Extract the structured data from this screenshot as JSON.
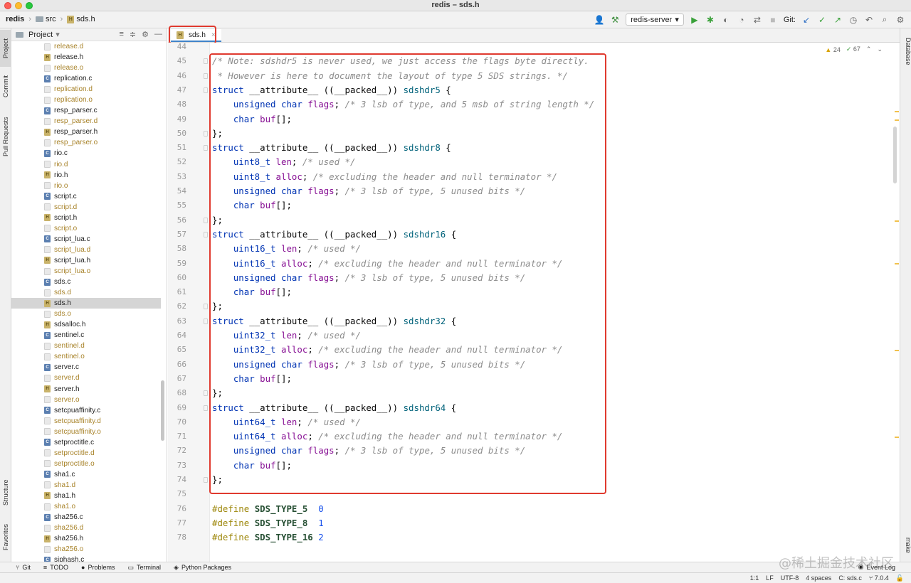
{
  "window": {
    "title": "redis – sds.h"
  },
  "breadcrumbs": [
    "redis",
    "src",
    "sds.h"
  ],
  "toolbar": {
    "run_config": "redis-server",
    "git_label": "Git:"
  },
  "left_strip": {
    "project": "Project",
    "commit": "Commit",
    "pull_requests": "Pull Requests",
    "structure": "Structure",
    "favorites": "Favorites"
  },
  "right_strip": {
    "database": "Database",
    "make": "make"
  },
  "project_panel": {
    "title": "Project"
  },
  "files": [
    {
      "name": "release.d",
      "type": "gen"
    },
    {
      "name": "release.h",
      "type": "h"
    },
    {
      "name": "release.o",
      "type": "gen"
    },
    {
      "name": "replication.c",
      "type": "c"
    },
    {
      "name": "replication.d",
      "type": "gen"
    },
    {
      "name": "replication.o",
      "type": "gen"
    },
    {
      "name": "resp_parser.c",
      "type": "c"
    },
    {
      "name": "resp_parser.d",
      "type": "gen"
    },
    {
      "name": "resp_parser.h",
      "type": "h"
    },
    {
      "name": "resp_parser.o",
      "type": "gen"
    },
    {
      "name": "rio.c",
      "type": "c"
    },
    {
      "name": "rio.d",
      "type": "gen"
    },
    {
      "name": "rio.h",
      "type": "h"
    },
    {
      "name": "rio.o",
      "type": "gen"
    },
    {
      "name": "script.c",
      "type": "c"
    },
    {
      "name": "script.d",
      "type": "gen"
    },
    {
      "name": "script.h",
      "type": "h"
    },
    {
      "name": "script.o",
      "type": "gen"
    },
    {
      "name": "script_lua.c",
      "type": "c"
    },
    {
      "name": "script_lua.d",
      "type": "gen"
    },
    {
      "name": "script_lua.h",
      "type": "h"
    },
    {
      "name": "script_lua.o",
      "type": "gen"
    },
    {
      "name": "sds.c",
      "type": "c"
    },
    {
      "name": "sds.d",
      "type": "gen"
    },
    {
      "name": "sds.h",
      "type": "h",
      "selected": true
    },
    {
      "name": "sds.o",
      "type": "gen"
    },
    {
      "name": "sdsalloc.h",
      "type": "h"
    },
    {
      "name": "sentinel.c",
      "type": "c"
    },
    {
      "name": "sentinel.d",
      "type": "gen"
    },
    {
      "name": "sentinel.o",
      "type": "gen"
    },
    {
      "name": "server.c",
      "type": "c"
    },
    {
      "name": "server.d",
      "type": "gen"
    },
    {
      "name": "server.h",
      "type": "h"
    },
    {
      "name": "server.o",
      "type": "gen"
    },
    {
      "name": "setcpuaffinity.c",
      "type": "c"
    },
    {
      "name": "setcpuaffinity.d",
      "type": "gen"
    },
    {
      "name": "setcpuaffinity.o",
      "type": "gen"
    },
    {
      "name": "setproctitle.c",
      "type": "c"
    },
    {
      "name": "setproctitle.d",
      "type": "gen"
    },
    {
      "name": "setproctitle.o",
      "type": "gen"
    },
    {
      "name": "sha1.c",
      "type": "c"
    },
    {
      "name": "sha1.d",
      "type": "gen"
    },
    {
      "name": "sha1.h",
      "type": "h"
    },
    {
      "name": "sha1.o",
      "type": "gen"
    },
    {
      "name": "sha256.c",
      "type": "c"
    },
    {
      "name": "sha256.d",
      "type": "gen"
    },
    {
      "name": "sha256.h",
      "type": "h"
    },
    {
      "name": "sha256.o",
      "type": "gen"
    },
    {
      "name": "siphash.c",
      "type": "c"
    }
  ],
  "editor": {
    "tab": "sds.h",
    "inspections": {
      "warnings": "24",
      "weak_warnings": "67"
    },
    "lines": [
      {
        "n": "44",
        "t": ""
      },
      {
        "n": "45",
        "t": "/* Note: sdshdr5 is never used, we just access the flags byte directly."
      },
      {
        "n": "46",
        "t": " * However is here to document the layout of type 5 SDS strings. */"
      },
      {
        "n": "47",
        "t": "struct __attribute__ ((__packed__)) sdshdr5 {"
      },
      {
        "n": "48",
        "t": "    unsigned char flags; /* 3 lsb of type, and 5 msb of string length */"
      },
      {
        "n": "49",
        "t": "    char buf[];"
      },
      {
        "n": "50",
        "t": "};"
      },
      {
        "n": "51",
        "t": "struct __attribute__ ((__packed__)) sdshdr8 {"
      },
      {
        "n": "52",
        "t": "    uint8_t len; /* used */"
      },
      {
        "n": "53",
        "t": "    uint8_t alloc; /* excluding the header and null terminator */"
      },
      {
        "n": "54",
        "t": "    unsigned char flags; /* 3 lsb of type, 5 unused bits */"
      },
      {
        "n": "55",
        "t": "    char buf[];"
      },
      {
        "n": "56",
        "t": "};"
      },
      {
        "n": "57",
        "t": "struct __attribute__ ((__packed__)) sdshdr16 {"
      },
      {
        "n": "58",
        "t": "    uint16_t len; /* used */"
      },
      {
        "n": "59",
        "t": "    uint16_t alloc; /* excluding the header and null terminator */"
      },
      {
        "n": "60",
        "t": "    unsigned char flags; /* 3 lsb of type, 5 unused bits */"
      },
      {
        "n": "61",
        "t": "    char buf[];"
      },
      {
        "n": "62",
        "t": "};"
      },
      {
        "n": "63",
        "t": "struct __attribute__ ((__packed__)) sdshdr32 {"
      },
      {
        "n": "64",
        "t": "    uint32_t len; /* used */"
      },
      {
        "n": "65",
        "t": "    uint32_t alloc; /* excluding the header and null terminator */"
      },
      {
        "n": "66",
        "t": "    unsigned char flags; /* 3 lsb of type, 5 unused bits */"
      },
      {
        "n": "67",
        "t": "    char buf[];"
      },
      {
        "n": "68",
        "t": "};"
      },
      {
        "n": "69",
        "t": "struct __attribute__ ((__packed__)) sdshdr64 {"
      },
      {
        "n": "70",
        "t": "    uint64_t len; /* used */"
      },
      {
        "n": "71",
        "t": "    uint64_t alloc; /* excluding the header and null terminator */"
      },
      {
        "n": "72",
        "t": "    unsigned char flags; /* 3 lsb of type, 5 unused bits */"
      },
      {
        "n": "73",
        "t": "    char buf[];"
      },
      {
        "n": "74",
        "t": "};"
      },
      {
        "n": "75",
        "t": ""
      },
      {
        "n": "76",
        "t": "#define SDS_TYPE_5  0"
      },
      {
        "n": "77",
        "t": "#define SDS_TYPE_8  1"
      },
      {
        "n": "78",
        "t": "#define SDS_TYPE_16 2"
      }
    ]
  },
  "bottom_tools": {
    "git": "Git",
    "todo": "TODO",
    "problems": "Problems",
    "terminal": "Terminal",
    "python_packages": "Python Packages",
    "event_log": "Event Log"
  },
  "watermark": "@稀土掘金技术社区",
  "status": {
    "position": "1:1",
    "line_sep": "LF",
    "encoding": "UTF-8",
    "indent": "4 spaces",
    "context": "C: sds.c",
    "version": "7.0.4"
  },
  "colors": {
    "highlight": "#e03a2f",
    "keyword": "#0033b3",
    "comment": "#8c8c8c",
    "preprocessor": "#9e880d",
    "number": "#1750eb"
  }
}
